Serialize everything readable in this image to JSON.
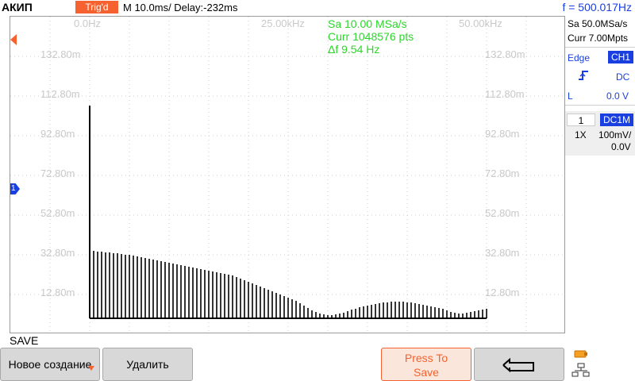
{
  "topbar": {
    "brand": "АКИП",
    "trig_status": "Trig'd",
    "timebase": "M 10.0ms/ Delay:-232ms",
    "frequency": "f = 500.017Hz"
  },
  "screen": {
    "freq_start": "0.0Hz",
    "freq_center": "25.00kHz",
    "freq_end": "50.00kHz",
    "measurements": {
      "sample_rate": "Sa 10.00 MSa/s",
      "points": "Curr 1048576 pts",
      "resolution": "Δf 9.54 Hz"
    },
    "y_labels": [
      "132.80m",
      "112.80m",
      "92.80m",
      "72.80m",
      "52.80m",
      "32.80m",
      "12.80m"
    ],
    "channel_marker": "1"
  },
  "right_panel": {
    "acq_rate": "Sa 50.0MSa/s",
    "acq_depth": "Curr 7.00Mpts",
    "trig_mode": "Edge",
    "trig_source": "CH1",
    "trig_coupling": "DC",
    "trig_slope": "L",
    "trig_level": "0.0 V",
    "ch_number": "1",
    "ch_coupling": "DC1M",
    "ch_probe": "1X",
    "ch_scale": "100mV/",
    "ch_offset": "0.0V"
  },
  "bottom": {
    "menu_title": "SAVE",
    "softkeys": [
      {
        "label": "Новое создание"
      },
      {
        "label": "Удалить"
      },
      {
        "label": "Press To Save"
      }
    ]
  },
  "chart_data": {
    "type": "bar",
    "note": "FFT spectrum bars; x in kHz, y in relative units",
    "x_range_khz": [
      0,
      50
    ],
    "spectrum": {
      "start_khz": 0.5,
      "spacing_khz": 0.5,
      "values": [
        85,
        84,
        84,
        83,
        83,
        82,
        82,
        81,
        80,
        80,
        79,
        78,
        77,
        76,
        75,
        74,
        73,
        72,
        71,
        70,
        69,
        68,
        67,
        66,
        65,
        64,
        63,
        62,
        61,
        60,
        59,
        58,
        57,
        56,
        55,
        54,
        52,
        50,
        48,
        46,
        44,
        42,
        40,
        38,
        36,
        34,
        32,
        30,
        28,
        26,
        24,
        22,
        19,
        16,
        13,
        10,
        8,
        6,
        5,
        4,
        4,
        5,
        6,
        7,
        9,
        11,
        12,
        14,
        15,
        16,
        17,
        18,
        19,
        20,
        20,
        21,
        21,
        21,
        21,
        20,
        20,
        19,
        18,
        17,
        16,
        15,
        14,
        13,
        12,
        10,
        8,
        7,
        6,
        6,
        7,
        8,
        9,
        10,
        11,
        12
      ]
    }
  },
  "colors": {
    "accent_orange": "#f5622f",
    "channel_blue": "#1a3fe0",
    "measure_green": "#2cd52c"
  }
}
